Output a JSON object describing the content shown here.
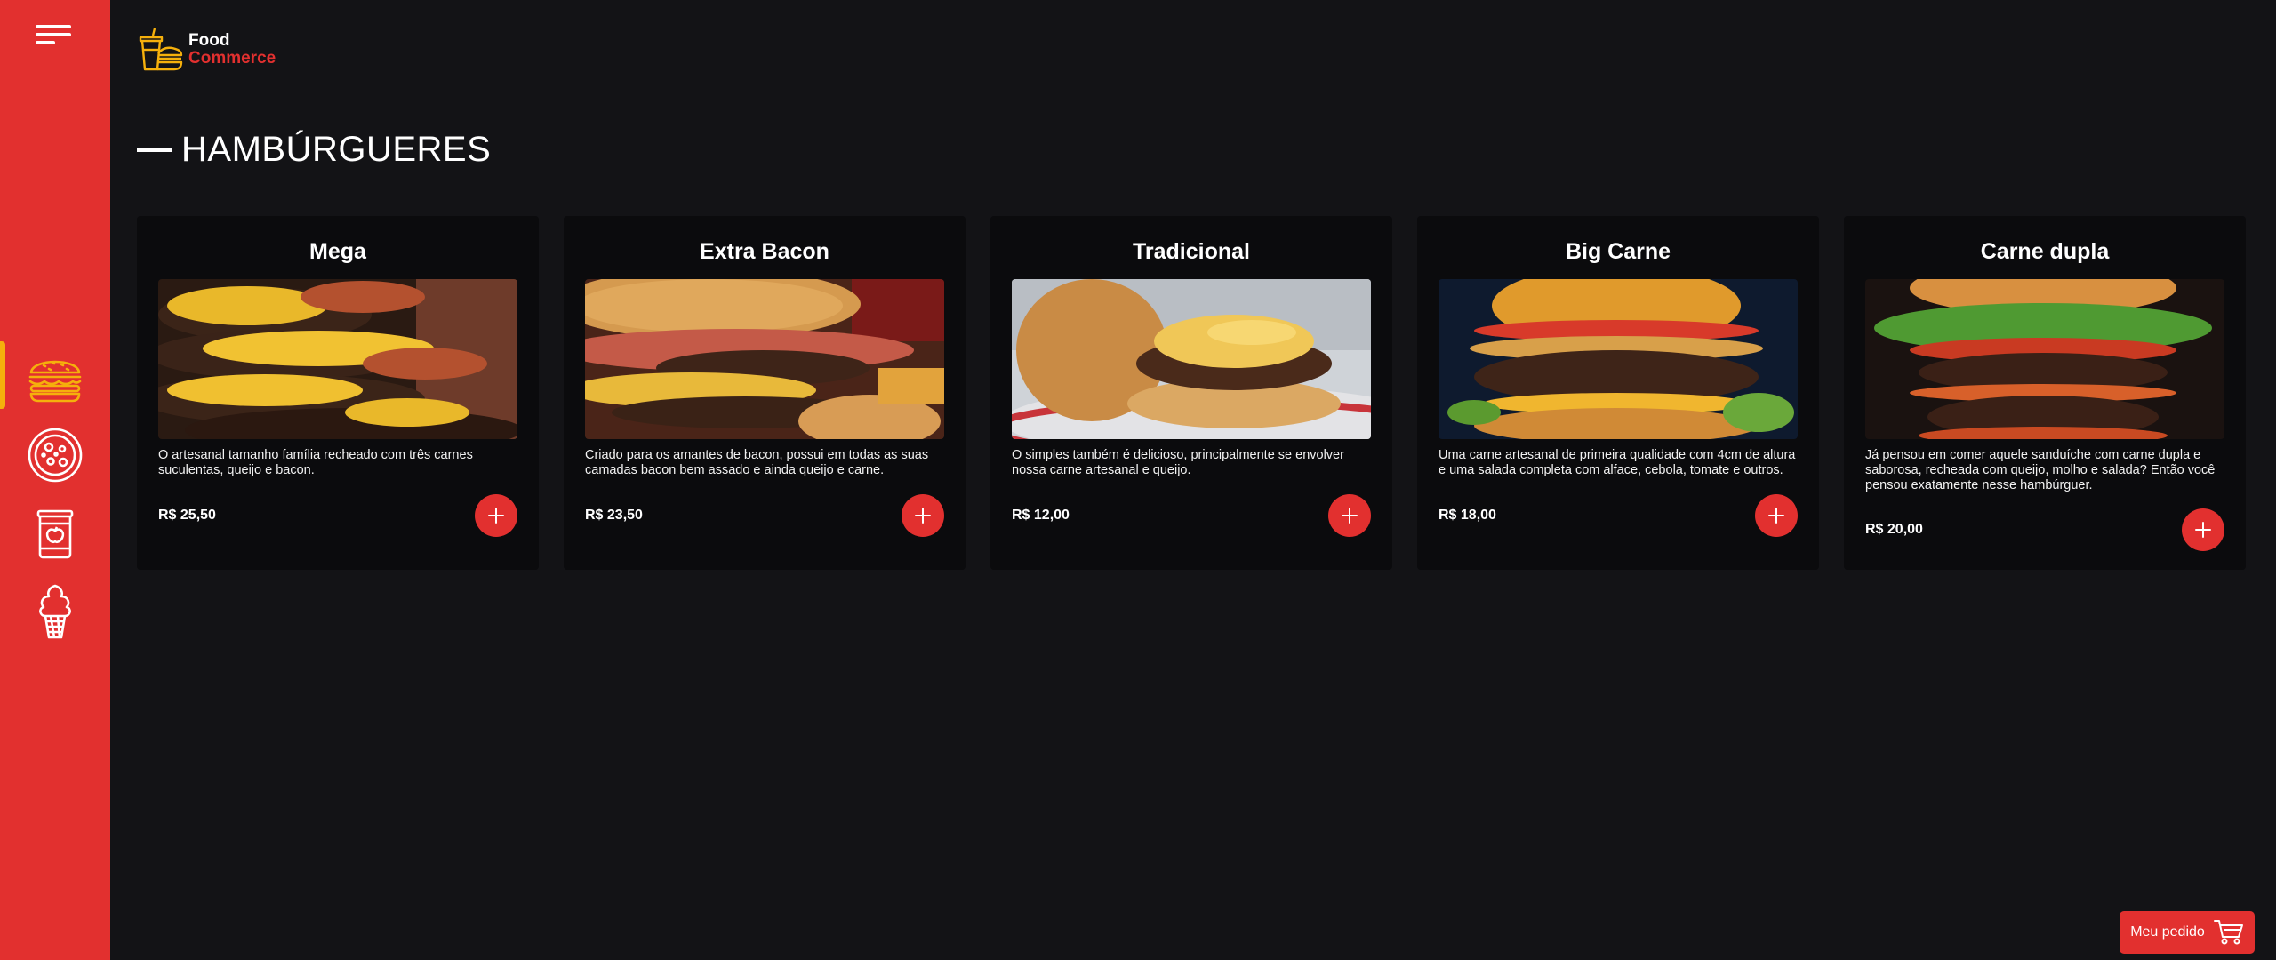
{
  "brand": {
    "line1": "Food",
    "line2": "Commerce",
    "accent": "#E2302F",
    "highlight": "#F5B00C"
  },
  "sidebar": {
    "items": [
      {
        "icon": "burger-icon",
        "active": true
      },
      {
        "icon": "pizza-icon",
        "active": false
      },
      {
        "icon": "soda-can-icon",
        "active": false
      },
      {
        "icon": "ice-cream-icon",
        "active": false
      }
    ]
  },
  "section": {
    "title": "HAMBÚRGUERES"
  },
  "products": [
    {
      "name": "Mega",
      "description": "O artesanal tamanho família recheado com três carnes suculentas, queijo e bacon.",
      "price": "R$ 25,50"
    },
    {
      "name": "Extra Bacon",
      "description": "Criado para os amantes de bacon, possui em todas as suas camadas bacon bem assado e ainda queijo e carne.",
      "price": "R$ 23,50"
    },
    {
      "name": "Tradicional",
      "description": "O simples também é delicioso, principalmente se envolver nossa carne artesanal e queijo.",
      "price": "R$ 12,00"
    },
    {
      "name": "Big Carne",
      "description": "Uma carne artesanal de primeira qualidade com 4cm de altura e uma salada completa com alface, cebola, tomate e outros.",
      "price": "R$ 18,00"
    },
    {
      "name": "Carne dupla",
      "description": "Já pensou em comer aquele sanduíche com carne dupla e saborosa, recheada com queijo, molho e salada? Então você pensou exatamente nesse hambúrguer.",
      "price": "R$ 20,00"
    }
  ],
  "order": {
    "label": "Meu pedido",
    "icon": "cart-icon"
  }
}
